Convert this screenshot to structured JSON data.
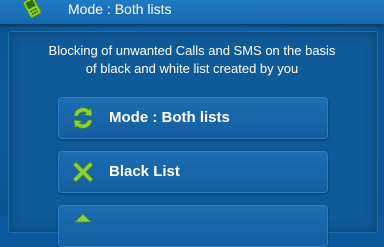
{
  "header": {
    "app_icon": "phone-block-icon",
    "title": "Mode : Both lists"
  },
  "description": {
    "line1": "Blocking of unwanted Calls and SMS on the basis",
    "line2": "of black and white list created by you"
  },
  "buttons": [
    {
      "label": "Mode : Both lists",
      "icon": "sync-arrows-icon"
    },
    {
      "label": "Black List",
      "icon": "x-mark-icon"
    },
    {
      "label": "",
      "icon": "green-icon-partial"
    }
  ],
  "colors": {
    "background": "#0e5fa3",
    "button": "#1766a9",
    "icon_green": "#8ad23a"
  }
}
